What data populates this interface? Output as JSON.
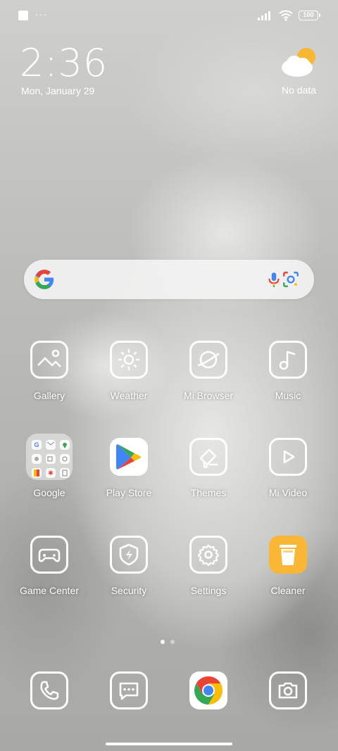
{
  "status_bar": {
    "left_icons": [
      "notification-square-icon",
      "more-dots-icon"
    ],
    "right_icons": [
      "signal-icon",
      "wifi-icon",
      "battery-icon"
    ],
    "battery": "100"
  },
  "clock": {
    "time": "2:36",
    "date": "Mon, January 29"
  },
  "weather": {
    "icon": "partly-cloudy-icon",
    "text": "No data"
  },
  "search": {
    "icons": [
      "google-g-logo",
      "mic-icon",
      "google-lens-icon"
    ]
  },
  "apps": {
    "row1": [
      {
        "label": "Gallery",
        "icon": "gallery-icon"
      },
      {
        "label": "Weather",
        "icon": "weather-sun-icon"
      },
      {
        "label": "Mi Browser",
        "icon": "browser-planet-icon"
      },
      {
        "label": "Music",
        "icon": "music-note-icon"
      }
    ],
    "row2": [
      {
        "label": "Google",
        "icon": "google-folder-icon"
      },
      {
        "label": "Play Store",
        "icon": "play-store-icon"
      },
      {
        "label": "Themes",
        "icon": "themes-brush-icon"
      },
      {
        "label": "Mi Video",
        "icon": "play-video-icon"
      }
    ],
    "row3": [
      {
        "label": "Game Center",
        "icon": "gamepad-icon"
      },
      {
        "label": "Security",
        "icon": "shield-bolt-icon"
      },
      {
        "label": "Settings",
        "icon": "gear-icon"
      },
      {
        "label": "Cleaner",
        "icon": "trash-cleaner-icon"
      }
    ]
  },
  "dock": [
    {
      "icon": "phone-icon"
    },
    {
      "icon": "messages-icon"
    },
    {
      "icon": "chrome-icon"
    },
    {
      "icon": "camera-icon"
    }
  ],
  "pager": {
    "pages": 2,
    "current": 1
  },
  "colors": {
    "cleaner": "#fab735",
    "google_blue": "#4285F4",
    "google_red": "#EA4335",
    "google_yellow": "#FBBC05",
    "google_green": "#34A853"
  }
}
